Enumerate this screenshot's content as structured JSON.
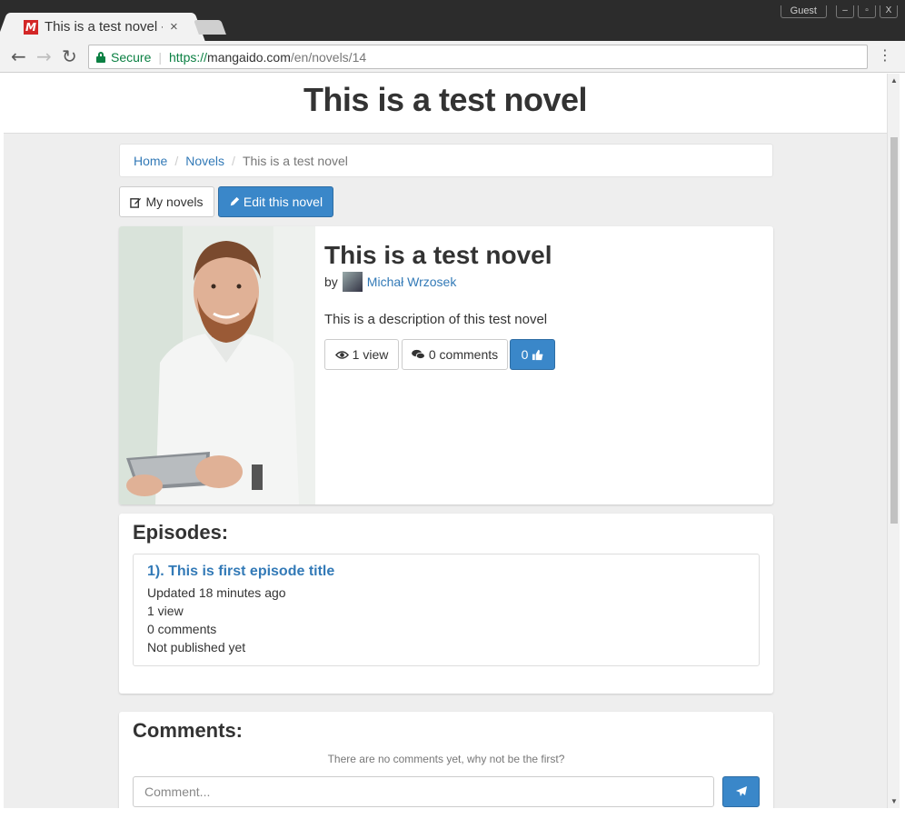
{
  "browser": {
    "tab_title": "This is a test novel - ",
    "tab_close": "×",
    "guest_label": "Guest",
    "window_buttons": [
      "–",
      "▫",
      "X"
    ],
    "secure_label": "Secure",
    "url_scheme": "https://",
    "url_host": "mangaido.com",
    "url_path": "/en/novels/14",
    "favicon_letter": "M"
  },
  "page": {
    "header_title": "This is a test novel",
    "breadcrumb": {
      "home": "Home",
      "novels": "Novels",
      "current": "This is a test novel"
    },
    "actions": {
      "my_novels": "My novels",
      "edit_novel": "Edit this novel"
    },
    "novel": {
      "title": "This is a test novel",
      "by_label": "by",
      "author": "Michał Wrzosek",
      "description": "This is a description of this test novel",
      "views": "1 view",
      "comments": "0 comments",
      "likes": "0"
    },
    "episodes": {
      "heading": "Episodes:",
      "items": [
        {
          "title": "1). This is first episode title",
          "updated": "Updated 18 minutes ago",
          "views": "1 view",
          "comments": "0 comments",
          "status": "Not published yet"
        }
      ]
    },
    "comments": {
      "heading": "Comments:",
      "empty_text": "There are no comments yet, why not be the first?",
      "placeholder": "Comment..."
    }
  },
  "colors": {
    "primary": "#3a87c9",
    "link": "#337ab7",
    "secure_green": "#0b8043",
    "favicon_red": "#d32727"
  }
}
